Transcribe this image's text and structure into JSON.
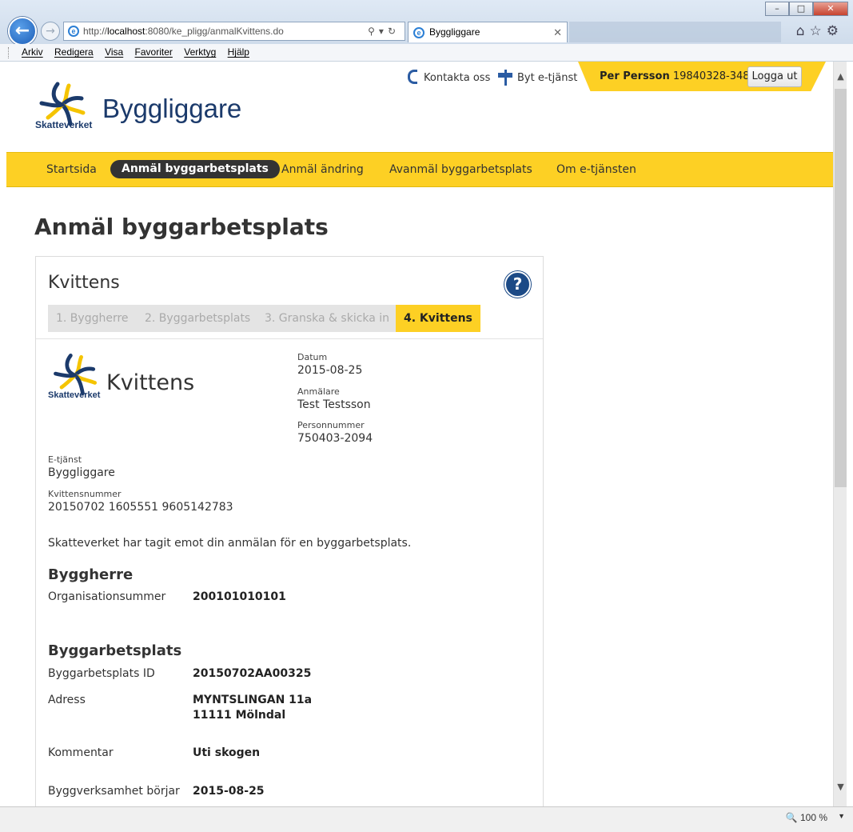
{
  "browser": {
    "url_prefix": "http://",
    "url_host": "localhost",
    "url_rest": ":8080/ke_pligg/anmalKvittens.do",
    "tab_title": "Byggliggare",
    "menu": [
      "Arkiv",
      "Redigera",
      "Visa",
      "Favoriter",
      "Verktyg",
      "Hjälp"
    ],
    "zoom": "100 %"
  },
  "header": {
    "logo_text": "Skatteverket",
    "site_title": "Byggliggare",
    "contact": "Kontakta oss",
    "switch_service": "Byt e-tjänst",
    "user_name": "Per Persson",
    "user_pnr": "19840328-3481",
    "logout": "Logga ut"
  },
  "nav": [
    "Startsida",
    "Anmäl byggarbetsplats",
    "Anmäl ändring",
    "Avanmäl byggarbetsplats",
    "Om e-tjänsten"
  ],
  "page_title": "Anmäl byggarbetsplats",
  "card": {
    "title": "Kvittens",
    "help": "?",
    "steps": [
      "1. Byggherre",
      "2. Byggarbetsplats",
      "3. Granska & skicka in",
      "4. Kvittens"
    ]
  },
  "receipt": {
    "logo_text": "Skatteverket",
    "title": "Kvittens",
    "datum_label": "Datum",
    "datum": "2015-08-25",
    "anmalare_label": "Anmälare",
    "anmalare": "Test Testsson",
    "pnr_label": "Personnummer",
    "pnr": "750403-2094",
    "etjanst_label": "E-tjänst",
    "etjanst": "Byggliggare",
    "kvnr_label": "Kvittensnummer",
    "kvnr": "20150702 1605551 9605142783",
    "message": "Skatteverket har tagit emot din anmälan för en byggarbetsplats."
  },
  "byggherre": {
    "heading": "Byggherre",
    "org_label": "Organisationsummer",
    "org_value": "200101010101"
  },
  "byggarbetsplats": {
    "heading": "Byggarbetsplats",
    "id_label": "Byggarbetsplats ID",
    "id_value": "20150702AA00325",
    "adress_label": "Adress",
    "adress_line1": "MYNTSLINGAN 11a",
    "adress_line2": "11111 Mölndal",
    "kommentar_label": "Kommentar",
    "kommentar_value": "Uti skogen",
    "start_label": "Byggverksamhet börjar",
    "start_value": "2015-08-25"
  }
}
